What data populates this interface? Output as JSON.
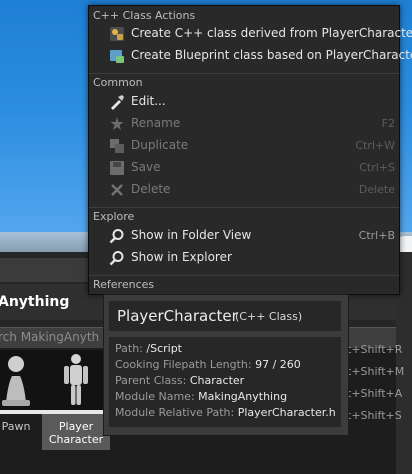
{
  "content_browser": {
    "title": "Anything",
    "search_placeholder": "rch MakingAnyth",
    "assets": [
      {
        "label": "Pawn"
      },
      {
        "label": "Player Character"
      }
    ]
  },
  "context_menu": {
    "sections": [
      {
        "header": "C++ Class Actions",
        "items": [
          {
            "label": "Create C++ class derived from PlayerCharacter",
            "icon": "cpp-class-icon",
            "shortcut": "",
            "enabled": true
          },
          {
            "label": "Create Blueprint class based on PlayerCharacter",
            "icon": "blueprint-class-icon",
            "shortcut": "",
            "enabled": true
          }
        ]
      },
      {
        "header": "Common",
        "items": [
          {
            "label": "Edit...",
            "icon": "edit-icon",
            "shortcut": "",
            "enabled": true
          },
          {
            "label": "Rename",
            "icon": "rename-icon",
            "shortcut": "F2",
            "enabled": false
          },
          {
            "label": "Duplicate",
            "icon": "duplicate-icon",
            "shortcut": "Ctrl+W",
            "enabled": false
          },
          {
            "label": "Save",
            "icon": "save-icon",
            "shortcut": "Ctrl+S",
            "enabled": false
          },
          {
            "label": "Delete",
            "icon": "delete-icon",
            "shortcut": "Delete",
            "enabled": false
          }
        ]
      },
      {
        "header": "Explore",
        "items": [
          {
            "label": "Show in Folder View",
            "icon": "search-folder-icon",
            "shortcut": "Ctrl+B",
            "enabled": true
          },
          {
            "label": "Show in Explorer",
            "icon": "search-explorer-icon",
            "shortcut": "",
            "enabled": true
          }
        ]
      },
      {
        "header": "References",
        "items": []
      }
    ],
    "partial_shortcuts": [
      "t+Shift+R",
      "t+Shift+M",
      "t+Shift+A",
      "t+Shift+S"
    ]
  },
  "tooltip": {
    "name": "PlayerCharacter",
    "kind": "(C++ Class)",
    "rows": [
      {
        "key": "Path:",
        "value": "/Script"
      },
      {
        "key": "Cooking Filepath Length:",
        "value": "97 / 260"
      },
      {
        "key": "Parent Class:",
        "value": "Character"
      },
      {
        "key": "Module Name:",
        "value": "MakingAnything"
      },
      {
        "key": "Module Relative Path:",
        "value": "PlayerCharacter.h"
      }
    ]
  },
  "colors": {
    "menu_bg": "#292929",
    "tooltip_bg": "#3c3c3c",
    "sky": "#2d8ee0",
    "selection": "#5a5a5a"
  }
}
